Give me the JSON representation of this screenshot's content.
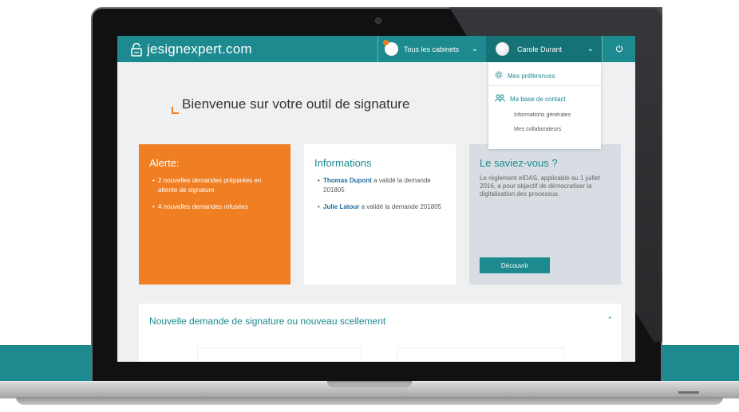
{
  "app": {
    "brand": "jesignexpert.com"
  },
  "nav": {
    "cabinets_label": "Tous les cabinets",
    "user_name": "Carole Durant"
  },
  "dropdown": {
    "preferences": "Mes préférences",
    "contacts": "Ma base de contact",
    "general_info": "Informations générales",
    "collaborators": "Mes collaborateurs"
  },
  "welcome": {
    "title": "Bienvenue sur votre outil de signature"
  },
  "alert_card": {
    "title": "Alerte:",
    "items": [
      "2 nouvelles demandes préparées en attente de signature",
      "4 nouvelles demandes refusées"
    ]
  },
  "info_card": {
    "title": "Informations",
    "items": [
      {
        "name": "Thomas Dupont",
        "text": " a validé la demande 201805"
      },
      {
        "name": "Julie Latour",
        "text": " a validé la demande 201805"
      }
    ]
  },
  "know_card": {
    "title": "Le saviez-vous ?",
    "text": "Le règlement eIDAS, applicable au 1 juillet 2016, a pour objectif de démocratiser la digitalisation des processus.",
    "button": "Découvrir"
  },
  "new_request": {
    "title": "Nouvelle demande de signature ou nouveau scellement"
  },
  "colors": {
    "teal": "#1c8a8f",
    "orange": "#f07e22",
    "link_blue": "#1c6c9b"
  },
  "icons": {
    "brand": "lock-icon",
    "power": "power-icon",
    "preferences": "gear-icon",
    "contacts": "people-icon",
    "collapse": "chevron-up-icon"
  }
}
